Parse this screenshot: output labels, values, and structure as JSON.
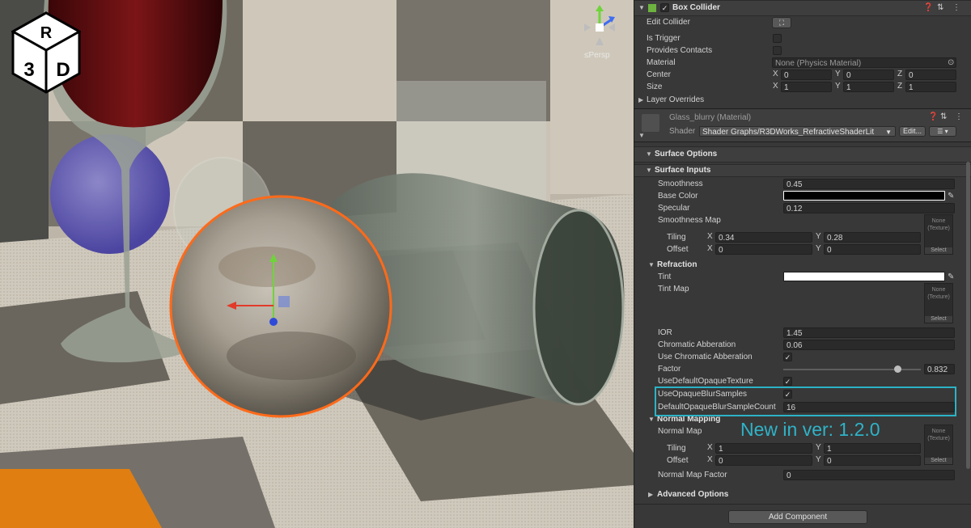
{
  "viewport": {
    "logo_text": "R3D",
    "persp_label": "Persp",
    "gizmo_axes": {
      "y": "y",
      "z": "z"
    }
  },
  "box_collider": {
    "title": "Box Collider",
    "edit_collider": "Edit Collider",
    "is_trigger": "Is Trigger",
    "provides_contacts": "Provides Contacts",
    "material_label": "Material",
    "material_value": "None (Physics Material)",
    "center_label": "Center",
    "center": {
      "x": "0",
      "y": "0",
      "z": "0"
    },
    "size_label": "Size",
    "size": {
      "x": "1",
      "y": "1",
      "z": "1"
    },
    "layer_overrides": "Layer Overrides",
    "axis": {
      "x": "X",
      "y": "Y",
      "z": "Z"
    }
  },
  "material": {
    "title": "Glass_blurry (Material)",
    "shader_label": "Shader",
    "shader_value": "Shader Graphs/R3DWorks_RefractiveShaderLit",
    "edit_label": "Edit...",
    "list_icon": "☰"
  },
  "surface_options": "Surface Options",
  "surface_inputs": {
    "title": "Surface Inputs",
    "smoothness_label": "Smoothness",
    "smoothness": "0.45",
    "base_color_label": "Base Color",
    "specular_label": "Specular",
    "specular": "0.12",
    "smoothness_map_label": "Smoothness Map",
    "tiling_label": "Tiling",
    "tiling": {
      "x": "0.34",
      "y": "0.28"
    },
    "offset_label": "Offset",
    "offset": {
      "x": "0",
      "y": "0"
    }
  },
  "texture_slot": {
    "none": "None",
    "texture": "(Texture)",
    "select": "Select"
  },
  "refraction": {
    "title": "Refraction",
    "tint_label": "Tint",
    "tint_map_label": "Tint Map",
    "ior_label": "IOR",
    "ior": "1.45",
    "chromatic_label": "Chromatic Abberation",
    "chromatic": "0.06",
    "use_chromatic_label": "Use Chromatic Abberation",
    "factor_label": "Factor",
    "factor": "0.832",
    "factor_fraction": 0.832,
    "use_default_opaque_label": "UseDefaultOpaqueTexture",
    "use_opaque_blur_label": "UseOpaqueBlurSamples",
    "default_blur_count_label": "DefaultOpaqueBlurSampleCount",
    "default_blur_count": "16"
  },
  "new_in_version": "New in ver: 1.2.0",
  "normal_mapping": {
    "title": "Normal Mapping",
    "normal_map_label": "Normal Map",
    "tiling_label": "Tiling",
    "tiling": {
      "x": "1",
      "y": "1"
    },
    "offset_label": "Offset",
    "offset": {
      "x": "0",
      "y": "0"
    },
    "factor_label": "Normal Map Factor",
    "factor": "0"
  },
  "advanced_options": "Advanced Options",
  "add_component": "Add Component",
  "colors": {
    "highlight": "#2bb3c6",
    "selection_outline": "#ff6a1a",
    "base_color": "#000000",
    "tint_color": "#ffffff"
  }
}
